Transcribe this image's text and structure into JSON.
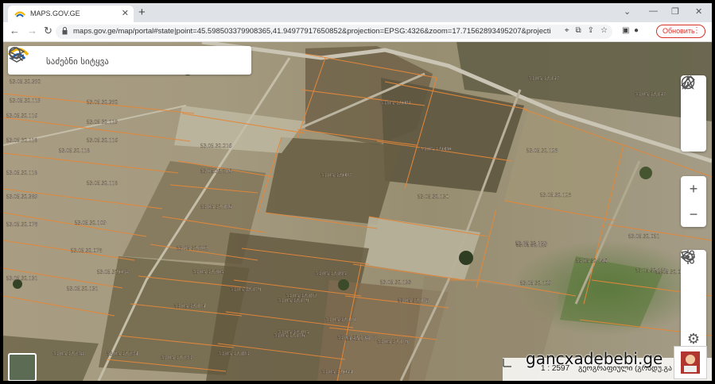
{
  "browser": {
    "tab_title": "MAPS.GOV.GE",
    "url": "maps.gov.ge/map/portal#state|point=45.598503379908365,41.94977917650852&projection=EPSG:4326&zoom=17.71562893495207&projection...",
    "update_label": "Обновить"
  },
  "search": {
    "placeholder": "საძებნი სიტყვა"
  },
  "map": {
    "scale": "1 : 2597",
    "coords_label": "გეოგრაფიული (გრადუ.გა",
    "parcels": [
      "53.05.32.392",
      "53.05.32.119",
      "53.05.32.392",
      "53.05.32.116",
      "53.05.32.119",
      "53.05.32.118",
      "53.05.32.118",
      "53.05.32.116",
      "53.05.32.118",
      "53.05.32.118",
      "53.05.32.389",
      "53.05.32.109",
      "53.05.32.078",
      "53.05.32.078",
      "53.05.32.078",
      "53.05.32.131",
      "53.05.32.131",
      "53.05.32.216",
      "53.05.32.216",
      "53.05.32.186",
      "53.05.32.202",
      "53.05.32.205",
      "53.05.32.184",
      "53.05.32.234",
      "53.05.32.258",
      "53.05.32.233",
      "53.05.32.183",
      "53.05.32.185",
      "53.05.32.179",
      "53.05.32.179",
      "53.05.32.195",
      "53.05.32.182",
      "53.05.32.176",
      "53.05.32.181",
      "53.05.32.177",
      "53.05.32.044",
      "53.05.32.081",
      "53.05.32.087",
      "53.05.32.080",
      "53.05.32.130",
      "53.05.32.133",
      "53.05.32.178",
      "53.05.32.178",
      "53.05.32.179",
      "53.05.32.147",
      "53.05.32.147",
      "53.05.32.128",
      "53.05.32.128",
      "53.05.32.129",
      "53.05.32.129",
      "53.05.32.051",
      "53.05.32.081",
      "53.05.32.146",
      "53.05.32.151",
      "53.05.32.129"
    ]
  },
  "watermark": "gancxadebebi.ge"
}
